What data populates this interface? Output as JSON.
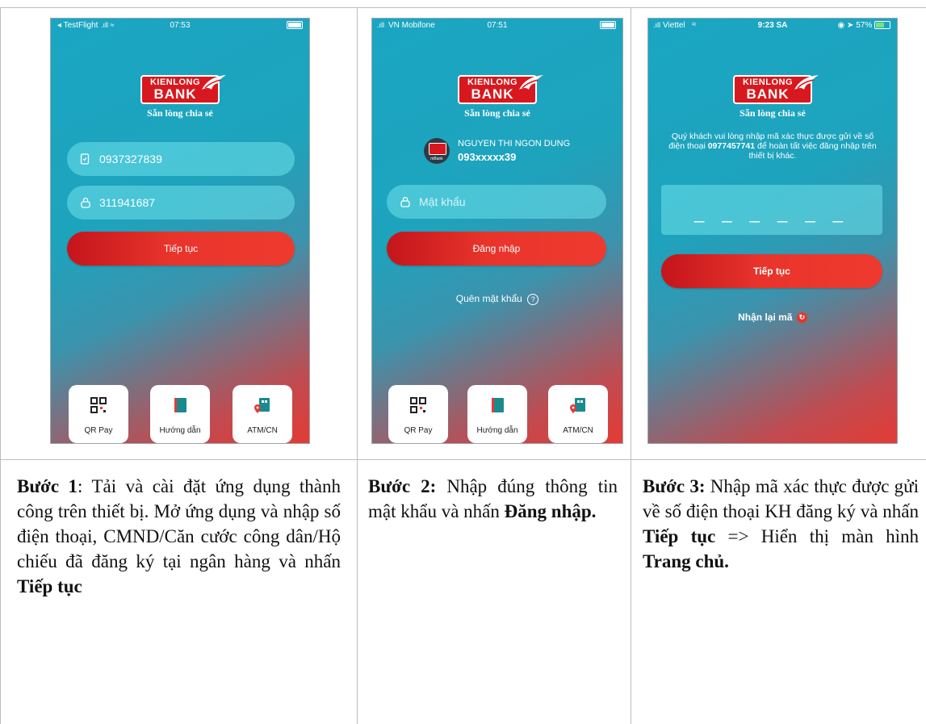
{
  "screens": [
    {
      "status": {
        "carrier": "◂ TestFlight",
        "time": "07:53"
      },
      "brand": {
        "top": "KIENLONG",
        "bottom": "BANK",
        "slogan": "Sẵn lòng chia sẻ"
      },
      "phone_value": "0937327839",
      "id_value": "311941687",
      "button_label": "Tiếp tục",
      "tiles": [
        "QR Pay",
        "Hướng dẫn",
        "ATM/CN"
      ]
    },
    {
      "status": {
        "carrier": "VN Mobifone",
        "time": "07:51"
      },
      "brand": {
        "top": "KIENLONG",
        "bottom": "BANK",
        "slogan": "Sẵn lòng chia sẻ"
      },
      "user_name": "NGUYEN THI NGON DUNG",
      "user_phone": "093xxxxx39",
      "avatar_label": "mBank",
      "password_placeholder": "Mật khẩu",
      "button_label": "Đăng nhập",
      "forgot_label": "Quên mật khẩu",
      "tiles": [
        "QR Pay",
        "Hướng dẫn",
        "ATM/CN"
      ]
    },
    {
      "status": {
        "carrier": "Viettel",
        "time": "9:23 SA",
        "battery": "57%"
      },
      "brand": {
        "top": "KIENLONG",
        "bottom": "BANK",
        "slogan": "Sẵn lòng chia sẻ"
      },
      "message_before": "Quý khách vui lòng nhập mã xác thực được gửi về số điện thoại ",
      "message_phone": "0977457741",
      "message_after": " để hoàn tất việc đăng nhập trên thiết bị khác.",
      "otp_placeholder": "_ _ _ _ _ _",
      "button_label": "Tiếp tục",
      "resend_label": "Nhận lại mã"
    }
  ],
  "captions": [
    {
      "step": "Bước 1",
      "text": ": Tải và cài đặt ứng dụng thành công trên thiết bị. Mở ứng dụng và nhập số điện thoại, CMND/Căn cước công dân/Hộ chiếu đã đăng ký tại ngân hàng và nhấn ",
      "bold_end": "Tiếp tục"
    },
    {
      "step": "Bước 2:",
      "text": " Nhập đúng thông tin mật khẩu và nhấn ",
      "bold_end": "Đăng nhập."
    },
    {
      "step": "Bước 3:",
      "text": " Nhập mã xác thực được gửi về số điện thoại KH đăng ký và nhấn ",
      "bold_mid": "Tiếp tục",
      "text2": " => Hiển thị màn hình ",
      "bold_end": "Trang chủ."
    }
  ]
}
